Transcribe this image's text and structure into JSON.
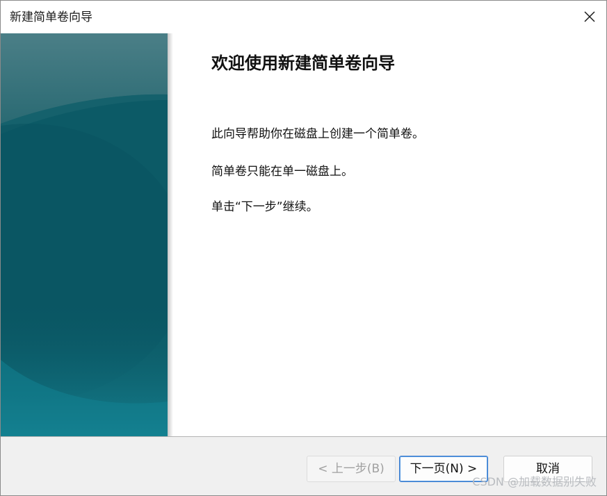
{
  "window": {
    "title": "新建简单卷向导"
  },
  "wizard": {
    "heading": "欢迎使用新建简单卷向导",
    "paragraphs": [
      "此向导帮助你在磁盘上创建一个简单卷。",
      "简单卷只能在单一磁盘上。",
      "单击“下一步”继续。"
    ]
  },
  "buttons": {
    "back_label": "< 上一步(B)",
    "next_label": "下一页(N) >",
    "cancel_label": "取消"
  },
  "watermark": "CSDN @加载数据别失败",
  "colors": {
    "side_panel_top": "#356f78",
    "side_panel_mid": "#0b5864",
    "side_panel_bottom": "#127383",
    "primary_border": "#3f7fd0",
    "footer_bg": "#f0f0f0"
  },
  "icons": {
    "close": "close-icon"
  }
}
